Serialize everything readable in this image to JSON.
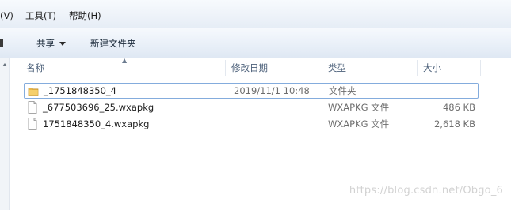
{
  "menubar": {
    "items": [
      {
        "label": "(V)"
      },
      {
        "label": "工具(T)"
      },
      {
        "label": "帮助(H)"
      }
    ]
  },
  "toolbar": {
    "share_label": "共享",
    "new_folder_label": "新建文件夹"
  },
  "file_list": {
    "columns": {
      "name": "名称",
      "date": "修改日期",
      "type": "类型",
      "size": "大小"
    },
    "rows": [
      {
        "name": "_1751848350_4",
        "date": "2019/11/1 10:48",
        "type": "文件夹",
        "size": "",
        "icon": "folder-icon"
      },
      {
        "name": "_677503696_25.wxapkg",
        "date": "",
        "type": "WXAPKG 文件",
        "size": "486 KB",
        "icon": "file-icon"
      },
      {
        "name": "1751848350_4.wxapkg",
        "date": "",
        "type": "WXAPKG 文件",
        "size": "2,618 KB",
        "icon": "file-icon"
      }
    ]
  },
  "watermark": {
    "text": "https://blog.csdn.net/Obgo_6"
  },
  "colors": {
    "focus_border": "#84acdd",
    "header_text": "#4c607a",
    "folder": "#e7b64a"
  }
}
